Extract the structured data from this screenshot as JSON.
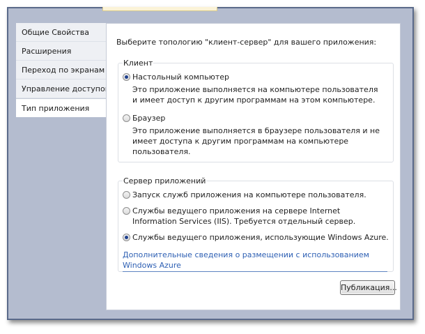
{
  "sidebar": {
    "items": [
      {
        "label": "Общие Свойства"
      },
      {
        "label": "Расширения"
      },
      {
        "label": "Переход по экранам"
      },
      {
        "label": "Управление доступом"
      },
      {
        "label": "Тип приложения"
      }
    ],
    "active_index": 4
  },
  "main": {
    "prompt": "Выберите топологию \"клиент-сервер\" для вашего приложения:",
    "client": {
      "title": "Клиент",
      "options": [
        {
          "label": "Настольный компьютер",
          "description": "Это приложение выполняется на компьютере пользователя и имеет доступ к другим программам на этом компьютере.",
          "checked": true
        },
        {
          "label": "Браузер",
          "description": "Это приложение выполняется в браузере пользователя и не имеет доступа к другим программам на компьютере пользователя.",
          "checked": false
        }
      ]
    },
    "server": {
      "title": "Сервер приложений",
      "options": [
        {
          "label": "Запуск служб приложения на компьютере пользователя.",
          "checked": false
        },
        {
          "label": "Службы ведущего приложения на сервере Internet Information Services (IIS).  Требуется отдельный сервер.",
          "checked": false
        },
        {
          "label": "Службы ведущего приложения, использующие Windows Azure.",
          "checked": true
        }
      ],
      "link": "Дополнительные сведения о размещении с использованием Windows Azure"
    },
    "publish_label": "Публикация..."
  },
  "colors": {
    "frame": "#5a6a8a",
    "chrome": "#b4bccf",
    "link": "#2d5fb3",
    "radio_dot": "#1d3f8c"
  }
}
